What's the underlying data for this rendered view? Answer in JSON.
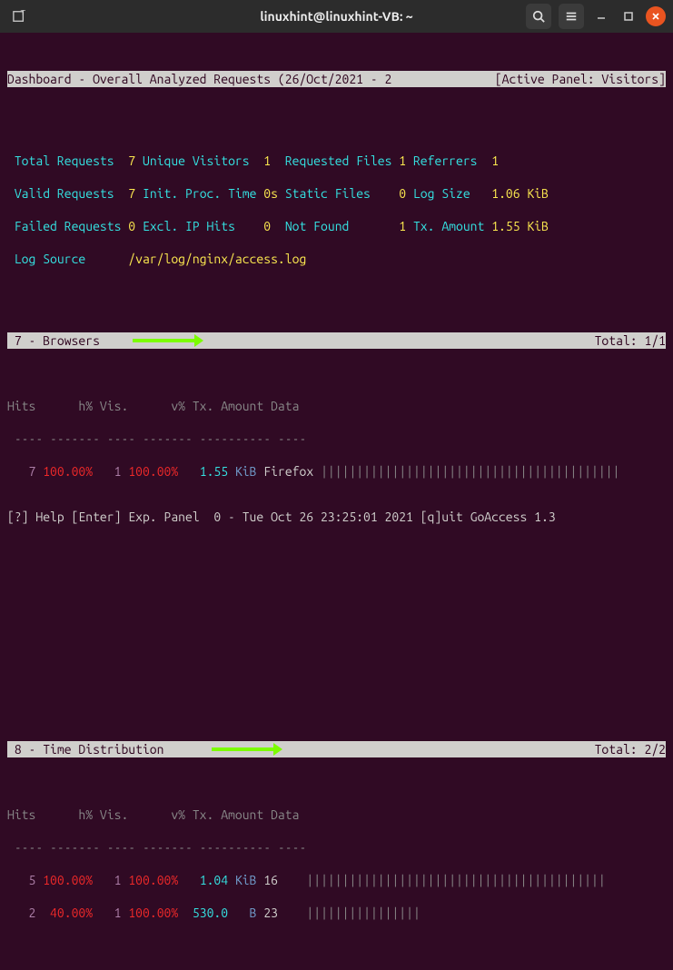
{
  "window": {
    "title": "linuxhint@linuxhint-VB: ~"
  },
  "header": {
    "left": "Dashboard - Overall Analyzed Requests (26/Oct/2021 - 2",
    "right": "[Active Panel: Visitors]"
  },
  "stats": {
    "row1": {
      "a_label": "Total Requests",
      "a_val": "7",
      "b_label": "Unique Visitors",
      "b_val": "1",
      "c_label": "Requested Files",
      "c_val": "1",
      "d_label": "Referrers",
      "d_val": "1"
    },
    "row2": {
      "a_label": "Valid Requests",
      "a_val": "7",
      "b_label": "Init. Proc. Time",
      "b_val": "0s",
      "c_label": "Static Files",
      "c_val": "0",
      "d_label": "Log Size",
      "d_val": "1.06 KiB"
    },
    "row3": {
      "a_label": "Failed Requests",
      "a_val": "0",
      "b_label": "Excl. IP Hits",
      "b_val": "0",
      "c_label": "Not Found",
      "c_val": "1",
      "d_label": "Tx. Amount",
      "d_val": "1.55 KiB"
    },
    "row4": {
      "a_label": "Log Source",
      "a_val": "/var/log/nginx/access.log"
    }
  },
  "panel1": {
    "title": " 7 - Browsers",
    "total": "Total: 1/1",
    "columns": "Hits      h% Vis.      v% Tx. Amount Data",
    "dashes": " ---- ------- ---- ------- ---------- ----",
    "rows": [
      {
        "hits": "7",
        "hp": "100.00%",
        "vis": "1",
        "vp": "100.00%",
        "amt": "1.55",
        "unit": "KiB",
        "data": "Firefox",
        "bar": "||||||||||||||||||||||||||||||||||||||||||"
      }
    ]
  },
  "panel2": {
    "title": " 8 - Time Distribution",
    "total": "Total: 2/2",
    "columns": "Hits      h% Vis.      v% Tx. Amount Data",
    "dashes": " ---- ------- ---- ------- ---------- ----",
    "rows": [
      {
        "hits": "5",
        "hp": "100.00%",
        "vis": "1",
        "vp": "100.00%",
        "amt": "1.04",
        "unit": "KiB",
        "data": "16",
        "bar": "||||||||||||||||||||||||||||||||||||||||||"
      },
      {
        "hits": "2",
        "hp": " 40.00%",
        "vis": "1",
        "vp": "100.00%",
        "amt": "530.0",
        "unit": "B",
        "data": "23",
        "bar": "||||||||||||||||"
      }
    ]
  },
  "footer": {
    "text": "[?] Help [Enter] Exp. Panel  0 - Tue Oct 26 23:25:01 2021 [q]uit GoAccess 1.3"
  }
}
